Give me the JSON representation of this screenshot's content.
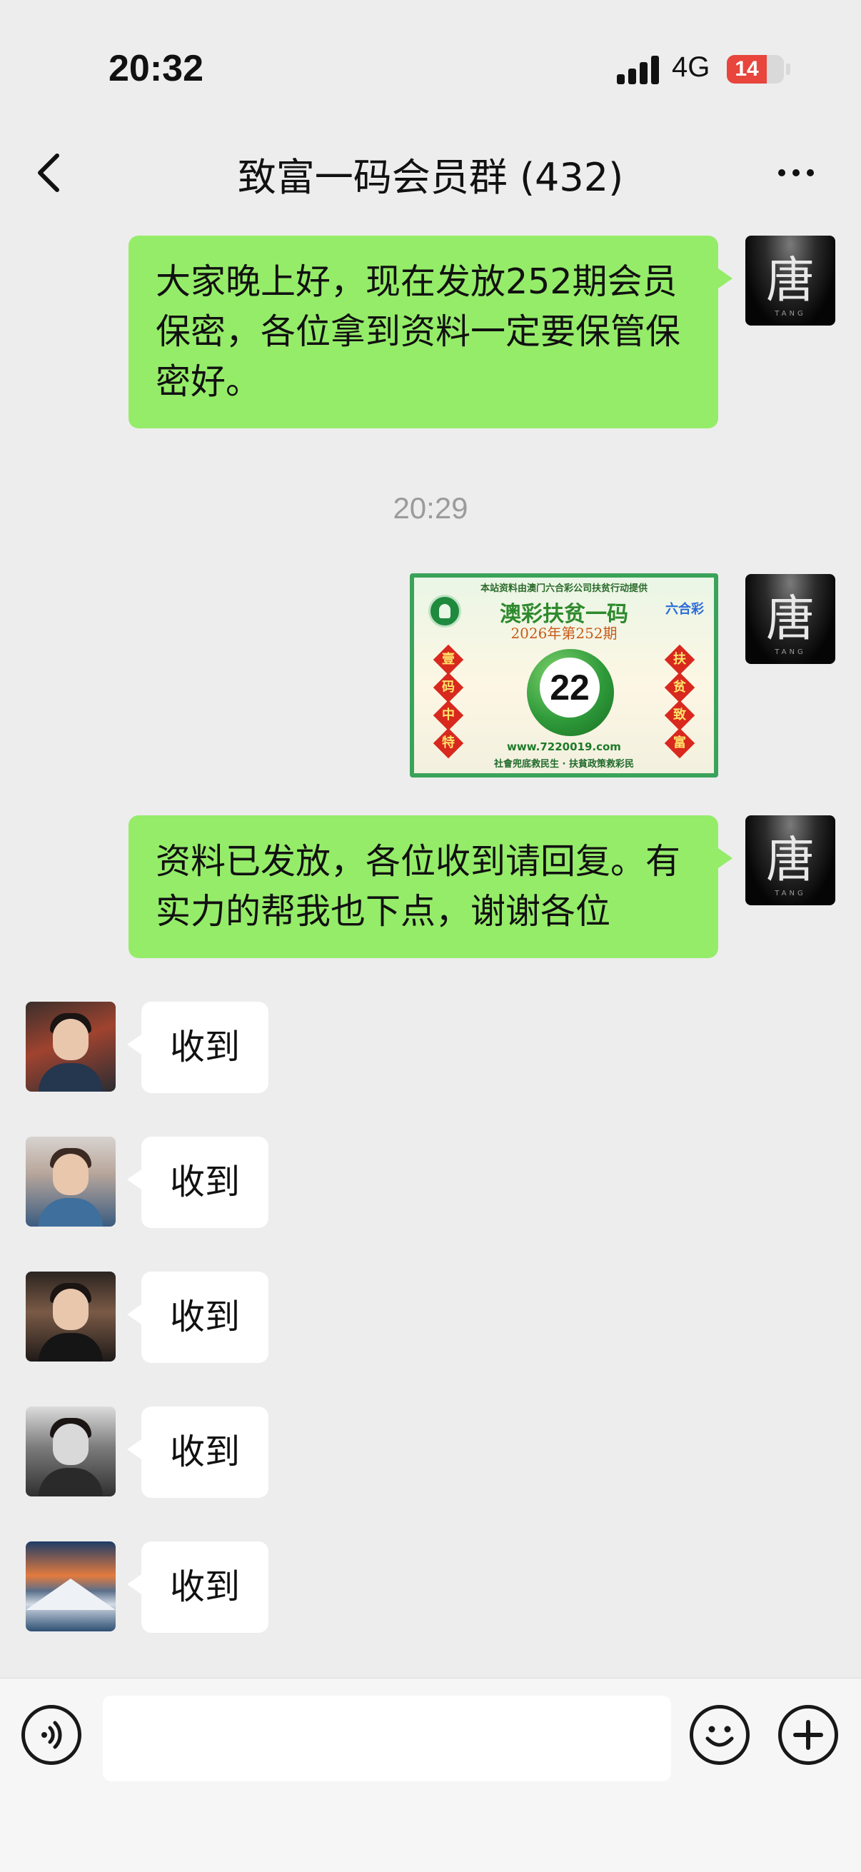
{
  "status_bar": {
    "time": "20:32",
    "network": "4G",
    "battery_level": "14",
    "battery_fraction": 0.14,
    "battery_color": "#e8453c"
  },
  "nav": {
    "title": "致富一码会员群 (432)",
    "back_icon": "chevron-left-icon",
    "more_icon": "more-dots-icon"
  },
  "sender": {
    "avatar_text": "唐",
    "avatar_subtext": "TANG"
  },
  "messages": [
    {
      "type": "text",
      "direction": "out",
      "text": "大家晚上好，现在发放252期会员保密，各位拿到资料一定要保管保密好。"
    },
    {
      "type": "timestamp",
      "text": "20:29"
    },
    {
      "type": "image",
      "direction": "out",
      "image": {
        "top_line": "本站资料由澳门六合彩公司扶贫行动提供",
        "headline": "澳彩扶贫一码",
        "issue": "2026年第252期",
        "brand": "六合彩",
        "left_chars": [
          "壹",
          "码",
          "中",
          "特"
        ],
        "right_chars": [
          "扶",
          "贫",
          "致",
          "富"
        ],
        "number": "22",
        "url": "www.7220019.com",
        "slogan": "社會兜底救民生 · 扶貧政策救彩民"
      }
    },
    {
      "type": "text",
      "direction": "out",
      "text": "资料已发放，各位收到请回复。有实力的帮我也下点，谢谢各位"
    },
    {
      "type": "text",
      "direction": "in",
      "text": "收到"
    },
    {
      "type": "text",
      "direction": "in",
      "text": "收到"
    },
    {
      "type": "text",
      "direction": "in",
      "text": "收到"
    },
    {
      "type": "text",
      "direction": "in",
      "text": "收到"
    },
    {
      "type": "text",
      "direction": "in",
      "text": "收到"
    }
  ],
  "input_bar": {
    "value": "",
    "voice_icon": "voice-icon",
    "emoji_icon": "emoji-icon",
    "plus_icon": "plus-icon"
  },
  "colors": {
    "background": "#ededed",
    "outgoing_bubble": "#95ec69",
    "incoming_bubble": "#ffffff",
    "timestamp": "#9b9b9b"
  }
}
